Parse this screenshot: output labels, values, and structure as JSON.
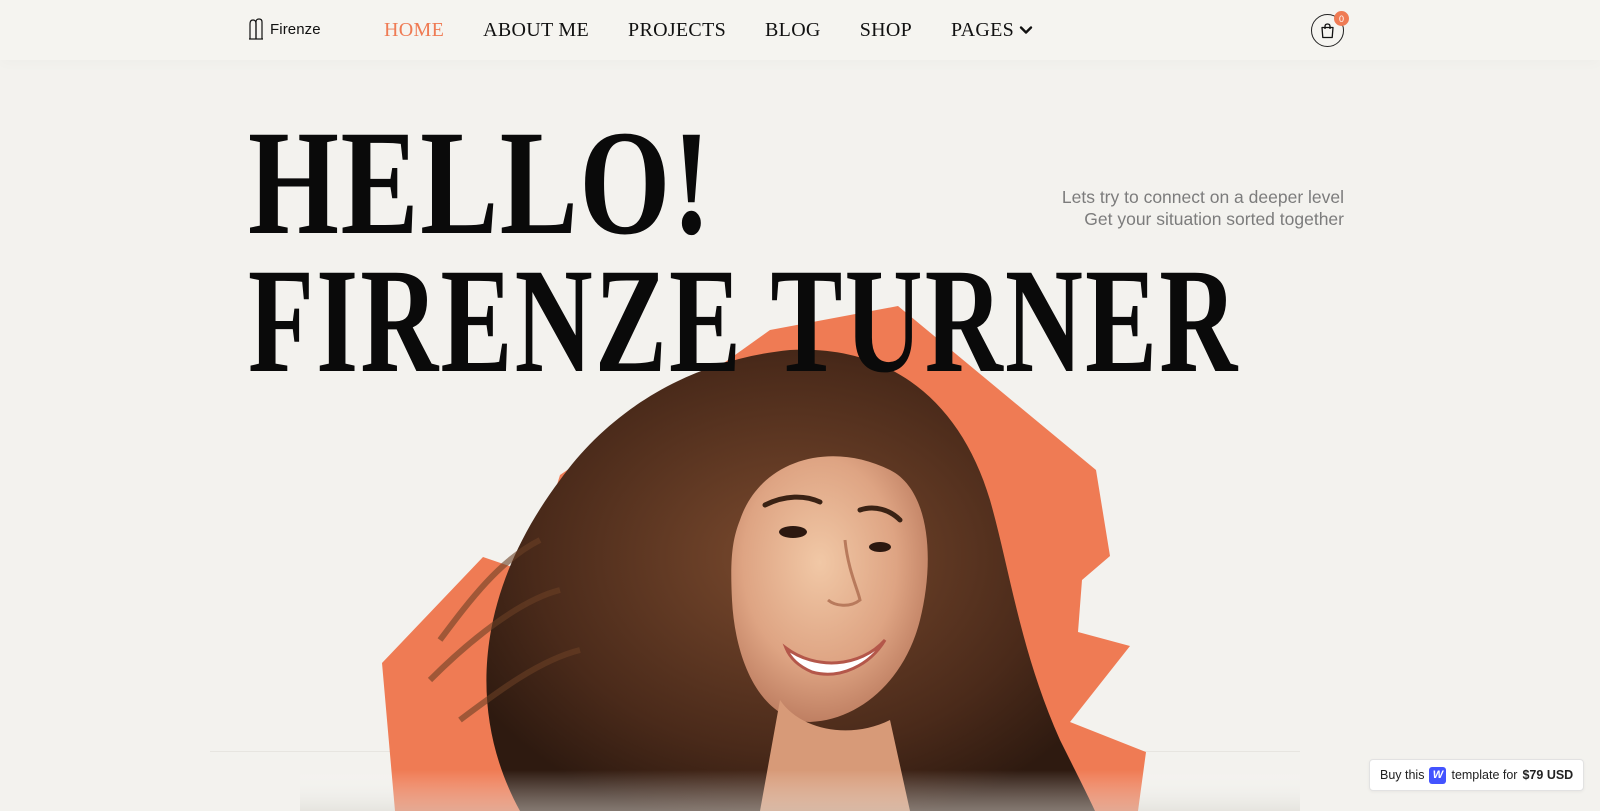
{
  "brand": {
    "name": "Firenze",
    "accent": "#ef7b54"
  },
  "nav": {
    "items": [
      {
        "label": "HOME",
        "active": true
      },
      {
        "label": "ABOUT ME",
        "active": false
      },
      {
        "label": "PROJECTS",
        "active": false
      },
      {
        "label": "BLOG",
        "active": false
      },
      {
        "label": "SHOP",
        "active": false
      },
      {
        "label": "PAGES",
        "active": false,
        "dropdown": true
      }
    ]
  },
  "cart": {
    "count": "0",
    "icon": "shopping-bag-icon"
  },
  "hero": {
    "line1": "HELLO!",
    "line2": "FIRENZE TURNER",
    "tagline_1": "Lets try to connect on a deeper level",
    "tagline_2": "Get your situation sorted together",
    "image": "portrait-photo"
  },
  "buy_badge": {
    "prefix": "Buy this",
    "icon": "webflow-icon",
    "icon_letter": "W",
    "middle": "template for",
    "price": "$79 USD"
  }
}
